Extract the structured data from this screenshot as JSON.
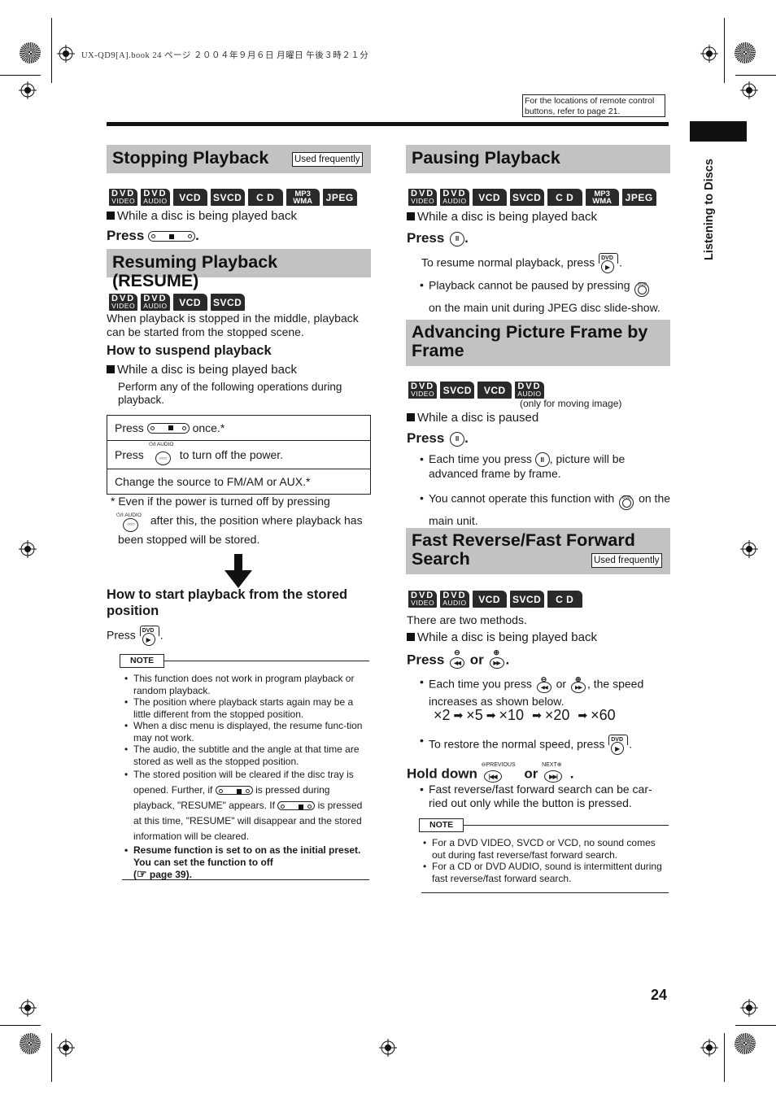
{
  "header": {
    "print_meta": "UX-QD9[A].book  24 ページ  ２００４年９月６日  月曜日  午後３時２１分",
    "reference_note": "For the locations of remote control buttons, refer to page 21.",
    "side_tab": "Listening to Discs",
    "page_number": "24"
  },
  "badge_labels": {
    "dvd": "DVD",
    "video": "VIDEO",
    "audio": "AUDIO",
    "vcd": "VCD",
    "svcd": "SVCD",
    "cd": "C D",
    "mp3": "MP3",
    "wma": "WMA",
    "jpeg": "JPEG"
  },
  "icons": {
    "stop": "stop-button-icon",
    "pause": "pause-button-icon",
    "dvd_play": "dvd-play-button-icon",
    "power_audio": "power-audio-button-icon",
    "unit_dvd": "main-unit-dvd-button-icon",
    "rewind": "rewind-button-icon",
    "fast_forward": "fast-forward-button-icon",
    "previous": "previous-button-icon",
    "next": "next-button-icon",
    "page_ref": "pointing-hand-icon"
  },
  "button_labels": {
    "dvd": "DVD",
    "power_audio": "⏻/I AUDIO",
    "previous": "⊖PREVIOUS",
    "next": "NEXT⊕",
    "pause": "II",
    "play": "▶",
    "rew": "◀◀",
    "ff": "▶▶",
    "prev_glyph": "|◀◀",
    "next_glyph": "▶▶|",
    "minus": "⊖",
    "plus": "⊕",
    "dots": "○○○"
  },
  "used_frequently": "Used frequently",
  "stopping": {
    "title": "Stopping Playback",
    "condition": "While a disc is being played back",
    "press": "Press",
    "period": "."
  },
  "resume": {
    "title": "Resuming Playback (RESUME)",
    "intro": "When playback is stopped in the middle, playback can be started from the stopped scene.",
    "suspend_heading": "How to suspend playback",
    "condition": "While a disc is being played back",
    "instruction": "Perform any of the following operations during playback.",
    "table": [
      {
        "pre": "Press",
        "post": "once.*"
      },
      {
        "pre": "Press",
        "post": "to turn off the power."
      },
      {
        "pre": "Change the source to FM/AM or AUX.*",
        "post": ""
      }
    ],
    "footnote_1": "* Even if the power is turned off by pressing",
    "footnote_2": "after this, the position where playback has been stopped will be stored.",
    "start_heading": "How to start playback from the stored position",
    "start_press": "Press",
    "note_label": "NOTE",
    "notes": [
      "This function does not work in program playback or random playback.",
      "The position where playback starts again may be a little different from the stopped position.",
      "When a disc menu is displayed, the resume func-tion may not work.",
      "The audio, the subtitle and the angle at that time are stored as well as the stopped position."
    ],
    "note5_a": "The stored position will be cleared if the disc tray is opened. Further, if",
    "note5_b": "is pressed during playback, \"RESUME\" appears. If",
    "note5_c": "is pressed at this time, \"RESUME\" will disappear and the stored information will be cleared.",
    "note6_a": "Resume function is set to on as the initial preset. You can set the function to off",
    "note6_b": "page 39)."
  },
  "pausing": {
    "title": "Pausing Playback",
    "condition": "While a disc is being played back",
    "press": "Press",
    "resume_text": "To resume normal playback, press",
    "bullet_a": "Playback cannot be paused by pressing",
    "bullet_b": "on the main unit during JPEG disc slide-show."
  },
  "advancing": {
    "title": "Advancing Picture Frame by Frame",
    "badge_note": "(only for moving image)",
    "condition": "While a disc is paused",
    "press": "Press",
    "bullet1_a": "Each time you press",
    "bullet1_b": ", picture will be advanced frame by frame.",
    "bullet2_a": "You cannot operate this function with",
    "bullet2_b": "on the main unit."
  },
  "fast": {
    "title": "Fast Reverse/Fast Forward Search",
    "intro": "There are two methods.",
    "condition": "While a disc is being played back",
    "press": "Press",
    "or": "or",
    "bullet1_a": "Each time you press",
    "bullet1_b": "or",
    "bullet1_c": ", the speed increases as shown below.",
    "speeds": [
      "×2",
      "×5",
      "×10",
      "×20",
      "×60"
    ],
    "restore": "To restore the normal speed, press",
    "hold_down": "Hold down",
    "hold_bullet": "Fast reverse/fast forward search can be car-ried out only while the button is pressed.",
    "note_label": "NOTE",
    "notes": [
      "For a DVD VIDEO, SVCD or VCD, no sound comes out during fast reverse/fast forward search.",
      "For a CD or DVD AUDIO, sound is intermittent during fast reverse/fast forward search."
    ]
  }
}
